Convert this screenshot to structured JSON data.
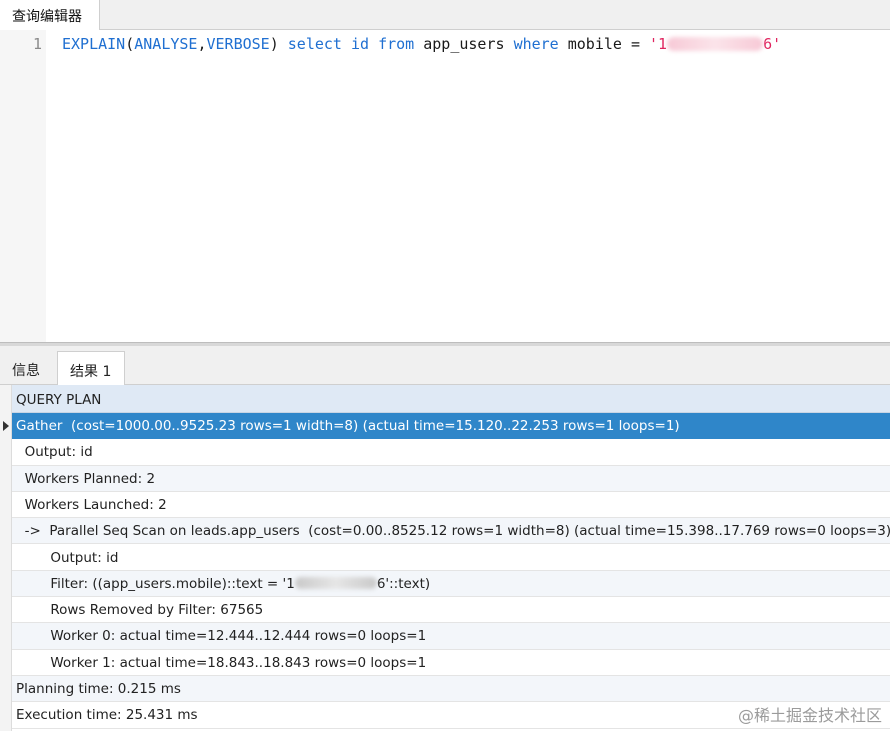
{
  "top_tab": {
    "label": "查询编辑器"
  },
  "editor": {
    "line_number": "1",
    "code": {
      "explain": "EXPLAIN",
      "open_paren": "(",
      "analyse": "ANALYSE",
      "comma": ",",
      "verbose": "VERBOSE",
      "close_paren": ")",
      "select": "select",
      "id": "id",
      "from": "from",
      "table": "app_users",
      "where": "where",
      "column": "mobile",
      "equals": "=",
      "string_open": "'1",
      "string_close": "6'"
    }
  },
  "bottom_tabs": {
    "info": "信息",
    "result": "结果 1"
  },
  "grid": {
    "header": "QUERY PLAN",
    "rows": [
      {
        "text": "Gather  (cost=1000.00..9525.23 rows=1 width=8) (actual time=15.120..22.253 rows=1 loops=1)",
        "selected": true
      },
      {
        "text": "  Output: id"
      },
      {
        "text": "  Workers Planned: 2"
      },
      {
        "text": "  Workers Launched: 2"
      },
      {
        "text": "  ->  Parallel Seq Scan on leads.app_users  (cost=0.00..8525.12 rows=1 width=8) (actual time=15.398..17.769 rows=0 loops=3)"
      },
      {
        "text": "        Output: id"
      },
      {
        "text_before": "        Filter: ((app_users.mobile)::text = '1",
        "text_after": "6'::text)"
      },
      {
        "text": "        Rows Removed by Filter: 67565"
      },
      {
        "text": "        Worker 0: actual time=12.444..12.444 rows=0 loops=1"
      },
      {
        "text": "        Worker 1: actual time=18.843..18.843 rows=0 loops=1"
      },
      {
        "text": "Planning time: 0.215 ms"
      },
      {
        "text": "Execution time: 25.431 ms"
      }
    ]
  },
  "watermark": "@稀土掘金技术社区",
  "icons": {
    "row_selector": "triangle-right-icon"
  },
  "colors": {
    "keyword": "#1f6fd1",
    "string": "#e0245e",
    "selected_row": "#2f86c9",
    "header": "#dfe9f5"
  }
}
